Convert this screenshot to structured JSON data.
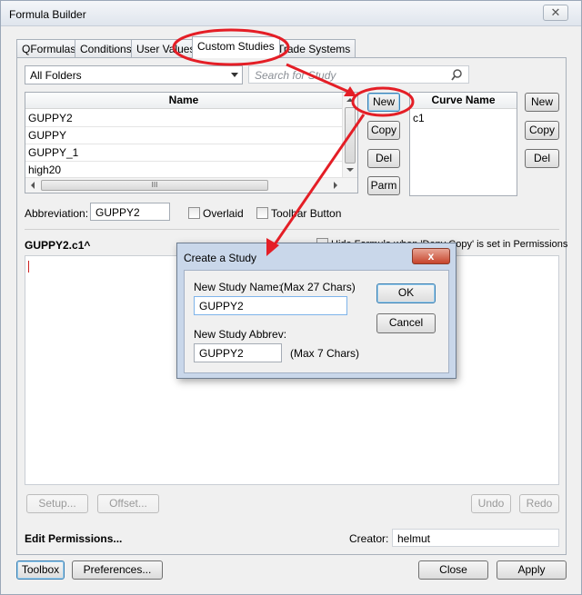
{
  "window": {
    "title": "Formula Builder",
    "close_glyph": "✕"
  },
  "tabs": [
    {
      "label": "QFormulas"
    },
    {
      "label": "Conditions"
    },
    {
      "label": "User Values"
    },
    {
      "label": "Custom Studies"
    },
    {
      "label": "Trade Systems"
    }
  ],
  "folder_select": {
    "value": "All Folders"
  },
  "search": {
    "placeholder": "Search for Study"
  },
  "study_list": {
    "header": "Name",
    "rows": [
      "GUPPY2",
      "GUPPY",
      "GUPPY_1",
      "high20"
    ],
    "scroll_thumb_glyph": "III"
  },
  "study_buttons": {
    "new": "New",
    "copy": "Copy",
    "del": "Del",
    "parm": "Parm"
  },
  "curve_list": {
    "header": "Curve Name",
    "rows": [
      "c1"
    ]
  },
  "curve_buttons": {
    "new": "New",
    "copy": "Copy",
    "del": "Del"
  },
  "abbreviation": {
    "label": "Abbreviation:",
    "value": "GUPPY2"
  },
  "overlaid": {
    "label": "Overlaid"
  },
  "toolbar_button": {
    "label": "Toolbar Button"
  },
  "formula": {
    "title": "GUPPY2.c1^",
    "hide_label": "Hide Formula when 'Deny Copy' is set in Permissions"
  },
  "editor_buttons": {
    "setup": "Setup...",
    "offset": "Offset...",
    "undo": "Undo",
    "redo": "Redo"
  },
  "permissions": {
    "label": "Edit Permissions...",
    "creator_label": "Creator:",
    "creator_value": "helmut"
  },
  "bottom_buttons": {
    "toolbox": "Toolbox",
    "preferences": "Preferences...",
    "close": "Close",
    "apply": "Apply"
  },
  "dialog": {
    "title": "Create a Study",
    "close_glyph": "x",
    "name_label": "New Study Name:",
    "name_hint": "(Max 27 Chars)",
    "name_value": "GUPPY2",
    "abbrev_label": "New Study Abbrev:",
    "abbrev_value": "GUPPY2",
    "abbrev_hint": "(Max 7 Chars)",
    "ok": "OK",
    "cancel": "Cancel"
  },
  "colors": {
    "annotation_red": "#e41e26",
    "accent_blue": "#3c7fb1"
  }
}
